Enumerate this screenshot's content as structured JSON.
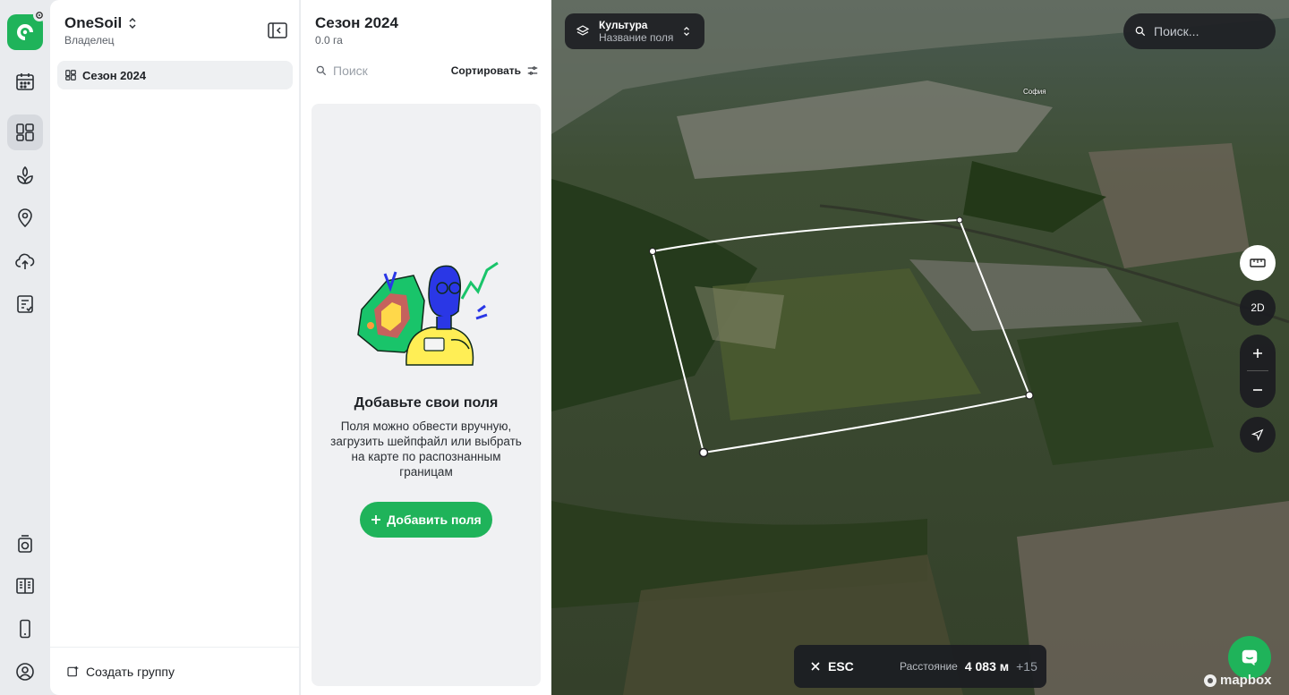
{
  "sidebar": {
    "org_name": "OneSoil",
    "org_role": "Владелец",
    "groups": [
      {
        "label": "Сезон 2024"
      }
    ],
    "create_group_label": "Создать группу"
  },
  "fields_panel": {
    "title": "Сезон 2024",
    "area": "0.0 га",
    "search_placeholder": "Поиск",
    "sort_label": "Сортировать",
    "empty_title": "Добавьте свои поля",
    "empty_text": "Поля можно обвести вручную, загрузить шейпфайл или выбрать на карте по распознанным границам",
    "add_button_label": "Добавить поля"
  },
  "map": {
    "layer_select": {
      "title": "Культура",
      "subtitle": "Название поля"
    },
    "search_placeholder": "Поиск...",
    "view_mode": "2D",
    "place_label": "София",
    "measure": {
      "esc_label": "ESC",
      "distance_label": "Расстояние",
      "distance_value": "4 083 м",
      "extra": "+15"
    },
    "attribution": "mapbox"
  },
  "colors": {
    "brand_green": "#1fb35a",
    "rail_bg": "#e9ebee",
    "dark_control": "#1e2024"
  }
}
